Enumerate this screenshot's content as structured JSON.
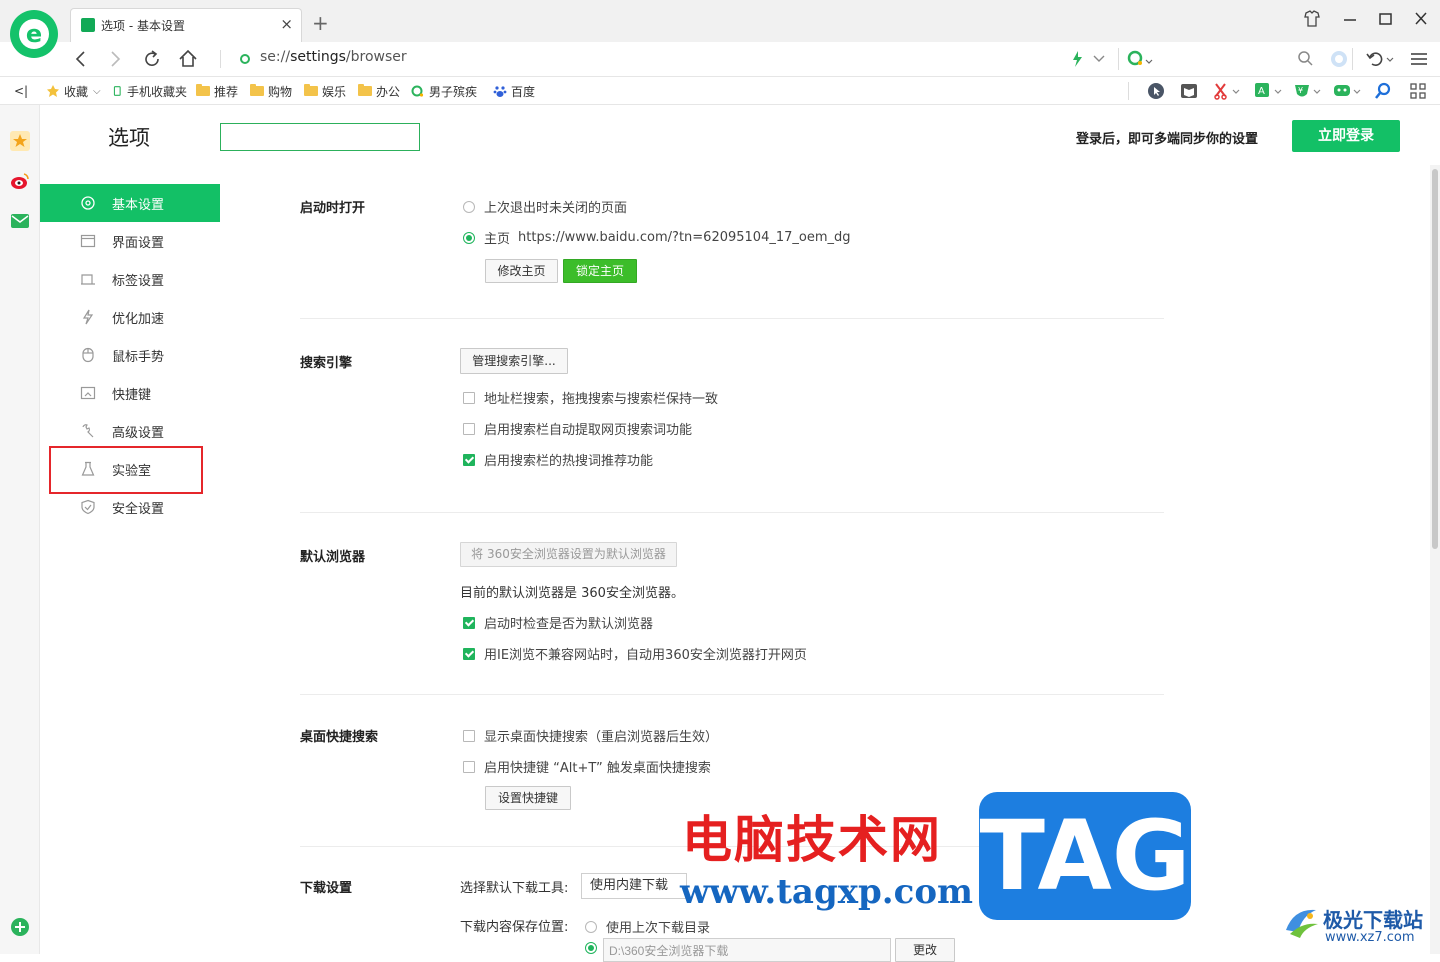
{
  "browser": {
    "tab_title": "选项 - 基本设置",
    "tab_close": "×",
    "new_tab": "+",
    "address_scheme": "se://",
    "address_host": "settings",
    "address_path": "/browser",
    "window_buttons": [
      "−",
      "□",
      "✕"
    ]
  },
  "bookmarks": {
    "toggle": "<|",
    "items": [
      {
        "label": "收藏",
        "icon": "star-icon"
      },
      {
        "label": "手机收藏夹",
        "icon": "phone-icon"
      },
      {
        "label": "推荐",
        "icon": "folder-icon"
      },
      {
        "label": "购物",
        "icon": "folder-icon"
      },
      {
        "label": "娱乐",
        "icon": "folder-icon"
      },
      {
        "label": "办公",
        "icon": "folder-icon"
      },
      {
        "label": "男子殡疾",
        "icon": "search-engine-icon"
      },
      {
        "label": "百度",
        "icon": "baidu-icon"
      }
    ]
  },
  "settings": {
    "title": "选项",
    "search_value": "",
    "login_hint": "登录后，即可多端同步你的设置",
    "login_button": "立即登录"
  },
  "menu": {
    "items": [
      {
        "label": "基本设置",
        "icon": "settings-icon",
        "active": true
      },
      {
        "label": "界面设置",
        "icon": "window-icon"
      },
      {
        "label": "标签设置",
        "icon": "tab-icon"
      },
      {
        "label": "优化加速",
        "icon": "lightning-icon"
      },
      {
        "label": "鼠标手势",
        "icon": "mouse-icon"
      },
      {
        "label": "快捷键",
        "icon": "keyboard-icon"
      },
      {
        "label": "高级设置",
        "icon": "wrench-icon"
      },
      {
        "label": "实验室",
        "icon": "flask-icon"
      },
      {
        "label": "安全设置",
        "icon": "shield-icon"
      }
    ]
  },
  "startup": {
    "title": "启动时打开",
    "option_restore": "上次退出时未关闭的页面",
    "option_home_label": "主页",
    "option_home_url": "https://www.baidu.com/?tn=62095104_17_oem_dg",
    "btn_modify": "修改主页",
    "btn_lock": "锁定主页"
  },
  "search": {
    "title": "搜索引擎",
    "btn_manage": "管理搜索引擎...",
    "opt1": "地址栏搜索，拖拽搜索与搜索栏保持一致",
    "opt2": "启用搜索栏自动提取网页搜索词功能",
    "opt3": "启用搜索栏的热搜词推荐功能"
  },
  "default_browser": {
    "title": "默认浏览器",
    "btn_set": "将 360安全浏览器设置为默认浏览器",
    "status": "目前的默认浏览器是 360安全浏览器。",
    "opt1": "启动时检查是否为默认浏览器",
    "opt2": "用IE浏览不兼容网站时，自动用360安全浏览器打开网页"
  },
  "desktop_search": {
    "title": "桌面快捷搜索",
    "opt1": "显示桌面快捷搜索（重启浏览器后生效）",
    "opt2": "启用快捷键 “Alt+T” 触发桌面快捷搜索",
    "btn_hotkey": "设置快捷键"
  },
  "download": {
    "title": "下载设置",
    "tool_label": "选择默认下载工具:",
    "tool_value": "使用内建下载",
    "location_label": "下载内容保存位置:",
    "opt_last": "使用上次下载目录",
    "path_value": "D:\\360安全浏览器下载",
    "btn_change": "更改"
  },
  "watermark": {
    "cn": "电脑技术网",
    "url": "www.tagxp.com",
    "tag": "TAG",
    "site2_title": "极光下载站",
    "site2_url": "www.xz7.com"
  },
  "colors": {
    "accent": "#13c066",
    "highlight_box": "#e5262b"
  }
}
